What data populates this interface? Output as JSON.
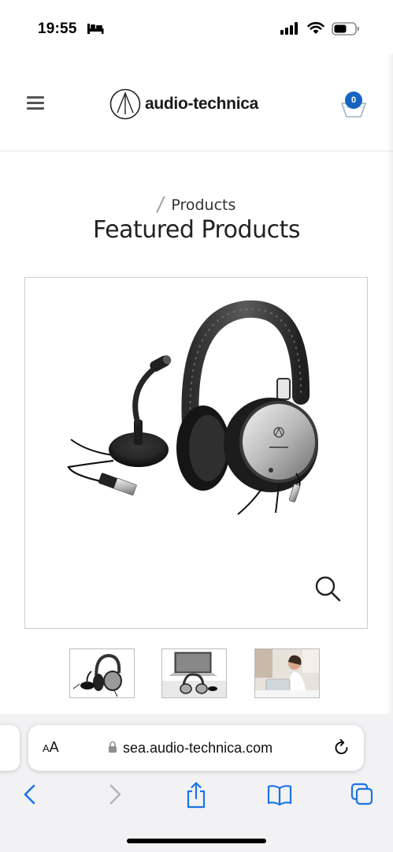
{
  "status_bar": {
    "time": "19:55",
    "icons": [
      "bed-icon",
      "cellular-signal-icon",
      "wifi-icon",
      "battery-icon"
    ]
  },
  "header": {
    "logo_text": "audio-technica",
    "cart_count": "0",
    "icons": [
      "menu-icon",
      "logo-mark-icon",
      "cart-icon"
    ]
  },
  "breadcrumb": {
    "separator": "/",
    "label": "Products"
  },
  "page": {
    "title": "Featured Products"
  },
  "product": {
    "main_image": "headset-and-desk-microphone",
    "thumbnails": [
      "headset-and-microphone",
      "headset-with-laptop",
      "person-using-headset"
    ],
    "zoom_icon": "magnifier-icon"
  },
  "browser": {
    "text_size_button_small": "A",
    "text_size_button_large": "A",
    "url": "sea.audio-technica.com",
    "toolbar_icons": [
      "back-icon",
      "forward-icon",
      "share-icon",
      "bookmarks-icon",
      "tabs-icon"
    ]
  },
  "colors": {
    "accent": "#1565c0",
    "safari_blue": "#1a73e8",
    "cart_badge": "#1565c0"
  }
}
